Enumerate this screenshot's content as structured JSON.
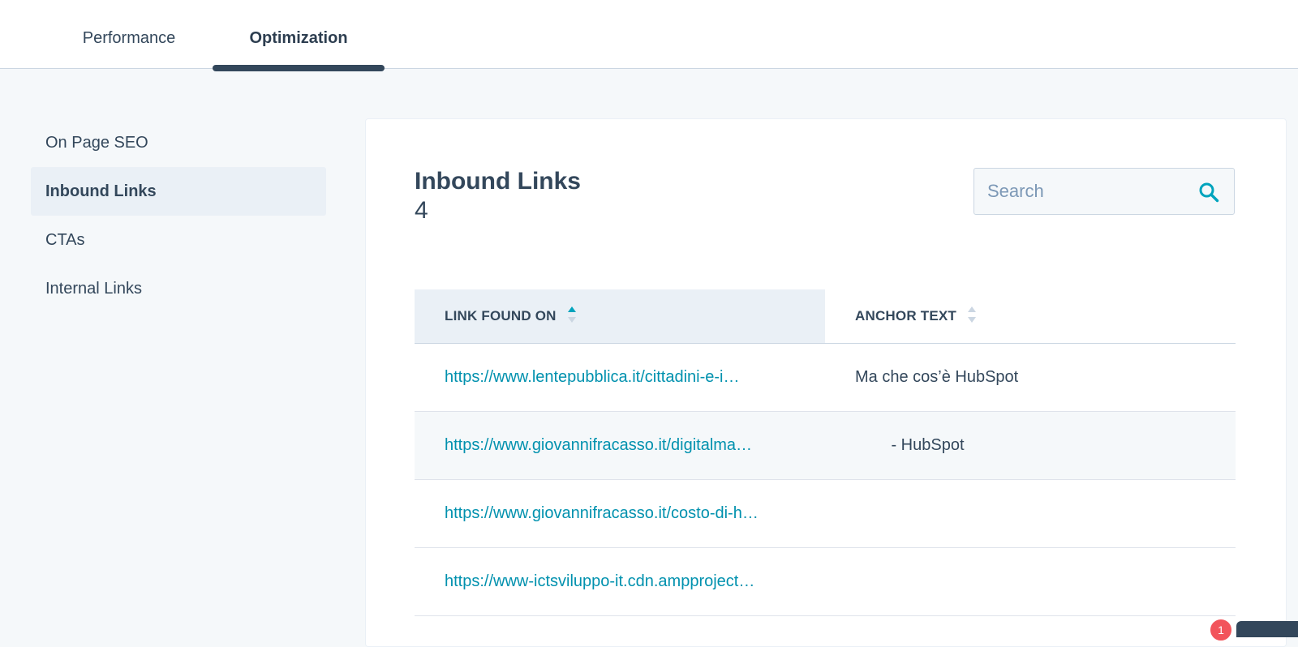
{
  "tabs": [
    {
      "label": "Performance",
      "active": false
    },
    {
      "label": "Optimization",
      "active": true
    }
  ],
  "sidebar": {
    "items": [
      {
        "label": "On Page SEO",
        "active": false
      },
      {
        "label": "Inbound Links",
        "active": true
      },
      {
        "label": "CTAs",
        "active": false
      },
      {
        "label": "Internal Links",
        "active": false
      }
    ]
  },
  "main": {
    "title": "Inbound Links",
    "count": "4",
    "search": {
      "placeholder": "Search",
      "value": ""
    },
    "table": {
      "columns": [
        "LINK FOUND ON",
        "ANCHOR TEXT"
      ],
      "rows": [
        {
          "link": "https://www.lentepubblica.it/cittadini-e-i…",
          "anchor": "Ma che cos’è HubSpot"
        },
        {
          "link": "https://www.giovannifracasso.it/digitalma…",
          "anchor": "        - HubSpot"
        },
        {
          "link": "https://www.giovannifracasso.it/costo-di-h…",
          "anchor": ""
        },
        {
          "link": "https://www-ictsviluppo-it.cdn.ampproject…",
          "anchor": ""
        }
      ]
    }
  },
  "notifications": {
    "badge_count": "1"
  },
  "colors": {
    "accent": "#33475b",
    "link": "#0091ae",
    "sort_active": "#00a4bd",
    "badge": "#f2545b"
  }
}
